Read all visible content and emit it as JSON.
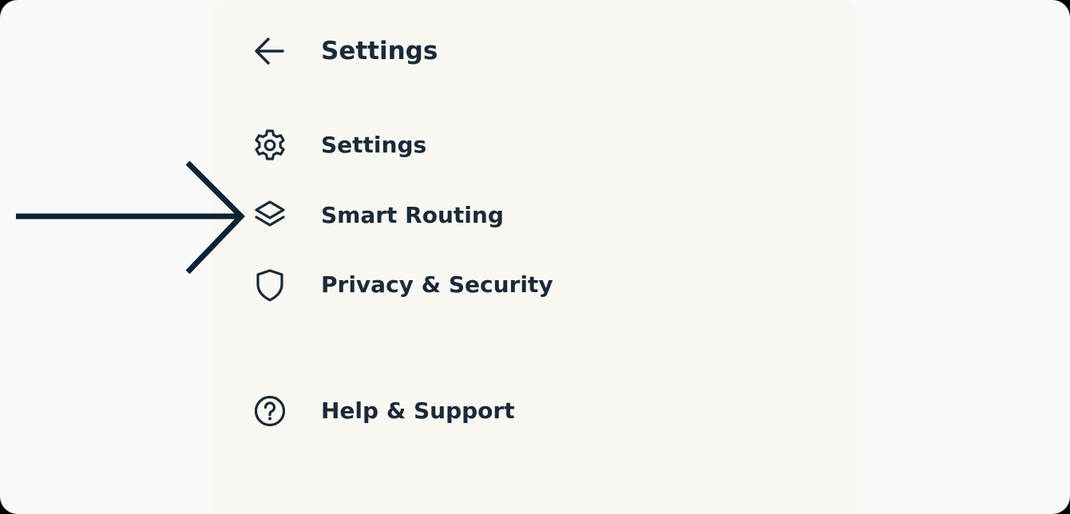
{
  "header": {
    "title": "Settings",
    "back_icon": "arrow-left-icon"
  },
  "menu": {
    "items": [
      {
        "label": "Settings",
        "icon": "gear-icon"
      },
      {
        "label": "Smart Routing",
        "icon": "layers-icon"
      },
      {
        "label": "Privacy & Security",
        "icon": "shield-icon"
      },
      {
        "label": "Help & Support",
        "icon": "help-circle-icon"
      }
    ]
  },
  "colors": {
    "text": "#1b2a38",
    "panel_bg": "#f8f7f2",
    "page_bg": "#f9f9fa",
    "annotation_arrow": "#0f2233"
  }
}
